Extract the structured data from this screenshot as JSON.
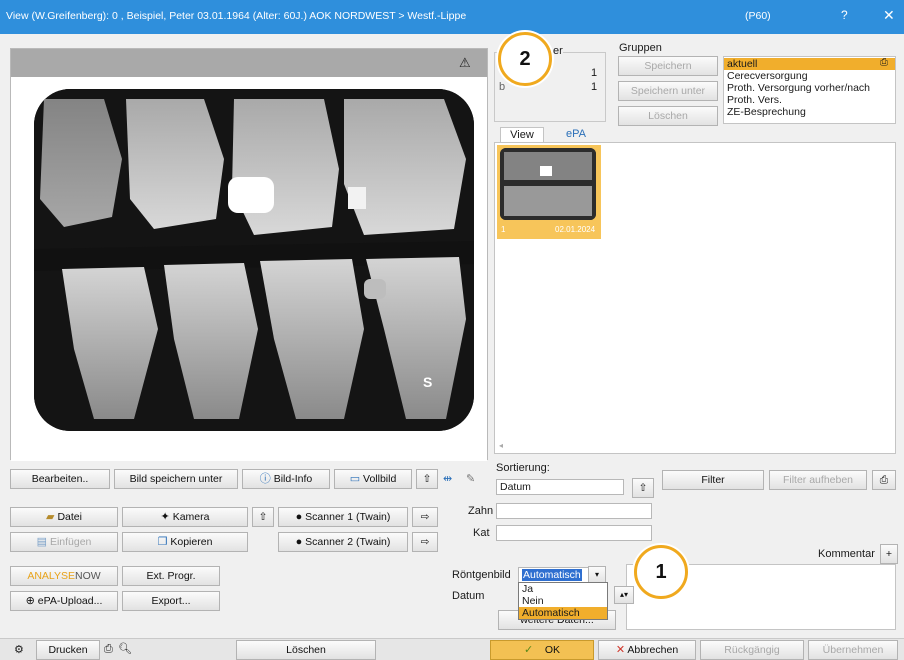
{
  "window": {
    "title": "View (W.Greifenberg): 0 , Beispiel, Peter 03.01.1964 (Alter: 60J.) AOK NORDWEST > Westf.-Lippe",
    "code": "(P60)",
    "help": "?",
    "close": "✕"
  },
  "viewer": {
    "warning_icon": "⚠",
    "side_label": "S"
  },
  "info_panel": {
    "header": "er",
    "count1": "1",
    "count2": "1",
    "label2": "b"
  },
  "gruppen": {
    "title": "Gruppen",
    "buttons": [
      "Speichern",
      "Speichern unter",
      "Löschen"
    ],
    "items": [
      "aktuell",
      "Cerecversorgung",
      "Proth. Versorgung vorher/nach",
      "Proth. Vers.",
      "ZE-Besprechung"
    ]
  },
  "tabs": [
    "View",
    "ePA"
  ],
  "thumbnail": {
    "left": "1",
    "right": "02.01.2024"
  },
  "sortierung": {
    "label": "Sortierung:",
    "value": "Datum"
  },
  "filter": {
    "filter": "Filter",
    "filter_aufheben": "Filter aufheben"
  },
  "toolbar": {
    "bearbeiten": "Bearbeiten..",
    "bild_speichern": "Bild speichern unter",
    "bild_info": "Bild-Info",
    "vollbild": "Vollbild"
  },
  "sources": {
    "datei": "Datei",
    "kamera": "Kamera",
    "scanner1": "Scanner 1 (Twain)",
    "einfuegen": "Einfügen",
    "kopieren": "Kopieren",
    "scanner2": "Scanner 2 (Twain)",
    "analyse_a": "ANALYSE",
    "analyse_b": "NOW",
    "ext_progr": "Ext. Progr.",
    "epa_upload": "ePA-Upload...",
    "export": "Export..."
  },
  "form": {
    "zahn": "Zahn",
    "kat": "Kat",
    "kommentar": "Kommentar",
    "roentgenbild": "Röntgenbild",
    "roentgen_value": "Automatisch",
    "datum": "Datum",
    "weitere": "weitere Daten..."
  },
  "dropdown_options": [
    "Ja",
    "Nein",
    "Automatisch"
  ],
  "bottom": {
    "drucken": "Drucken",
    "loeschen": "Löschen",
    "ok": "OK",
    "abbrechen": "Abbrechen",
    "rueckgaengig": "Rückgängig",
    "uebernehmen": "Übernehmen"
  },
  "callouts": [
    "1",
    "2"
  ],
  "colors": {
    "titlebar": "#2f8fdc",
    "accent": "#f1ae2c",
    "callout_border": "#f0a91e",
    "analyse": "#e8a31a"
  }
}
